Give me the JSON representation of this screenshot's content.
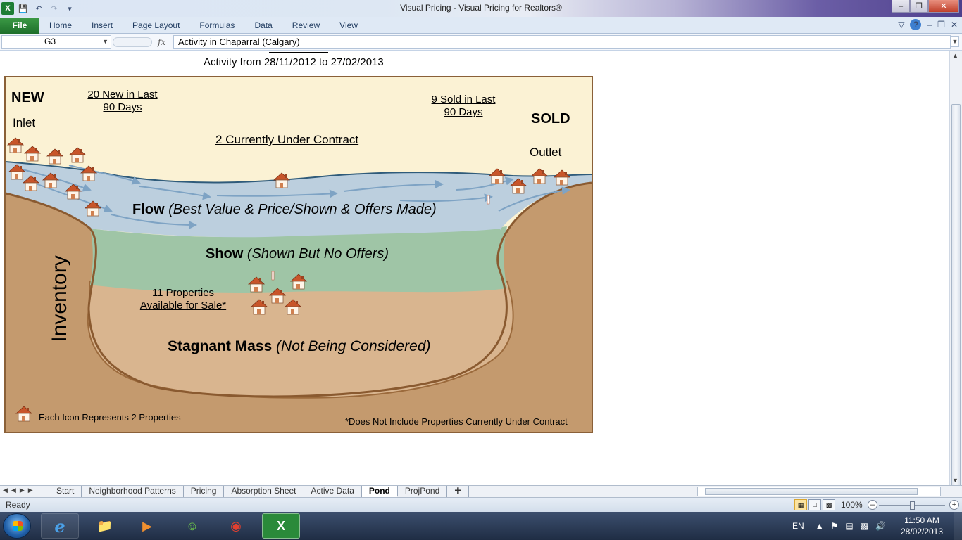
{
  "window": {
    "title": "Visual Pricing  -  Visual Pricing for Realtors®",
    "controls": [
      "minimize",
      "restore",
      "close"
    ]
  },
  "quick_access": [
    "excel-icon",
    "save-icon",
    "undo-icon",
    "redo-icon",
    "customize-icon"
  ],
  "ribbon": {
    "file_label": "File",
    "tabs": [
      "Home",
      "Insert",
      "Page Layout",
      "Formulas",
      "Data",
      "Review",
      "View"
    ]
  },
  "formula_bar": {
    "name_box": "G3",
    "fx_label": "fx",
    "value": "Activity in Chaparral (Calgary)"
  },
  "sheet": {
    "activity_line": "Activity from 28/11/2012 to 27/02/2013",
    "pond": {
      "new_label": "NEW",
      "inlet_label": "Inlet",
      "new_count_line1": "20 New in Last",
      "new_count_line2": "90 Days",
      "sold_count_line1": "9 Sold in Last",
      "sold_count_line2": "90 Days",
      "sold_label": "SOLD",
      "outlet_label": "Outlet",
      "under_contract": "2 Currently Under Contract",
      "flow_title": "Flow",
      "flow_desc": "(Best Value & Price/Shown & Offers Made)",
      "show_title": "Show",
      "show_desc": "(Shown But No Offers)",
      "available_line1": "11 Properties",
      "available_line2": "Available for Sale*",
      "inventory_label": "Inventory",
      "stagnant_title": "Stagnant Mass",
      "stagnant_desc": "(Not Being Considered)",
      "legend": "Each Icon Represents 2 Properties",
      "footnote": "*Does Not Include Properties Currently Under Contract",
      "colors": {
        "sky": "#fbf2d4",
        "flow_water": "#bccfde",
        "show_layer": "#9fc5a6",
        "stagnant": "#d9b58f",
        "earth": "#c49a6e",
        "border": "#8a6038",
        "house_roof": "#c8552a"
      }
    }
  },
  "sheet_tabs": {
    "tabs": [
      "Start",
      "Neighborhood Patterns",
      "Pricing",
      "Absorption Sheet",
      "Active Data",
      "Pond",
      "ProjPond"
    ],
    "active": "Pond"
  },
  "status_bar": {
    "status": "Ready",
    "zoom": "100%"
  },
  "taskbar": {
    "apps": [
      "internet-explorer",
      "file-explorer",
      "media-player",
      "messenger",
      "chrome",
      "excel"
    ],
    "language": "EN",
    "time": "11:50 AM",
    "date": "28/02/2013"
  }
}
